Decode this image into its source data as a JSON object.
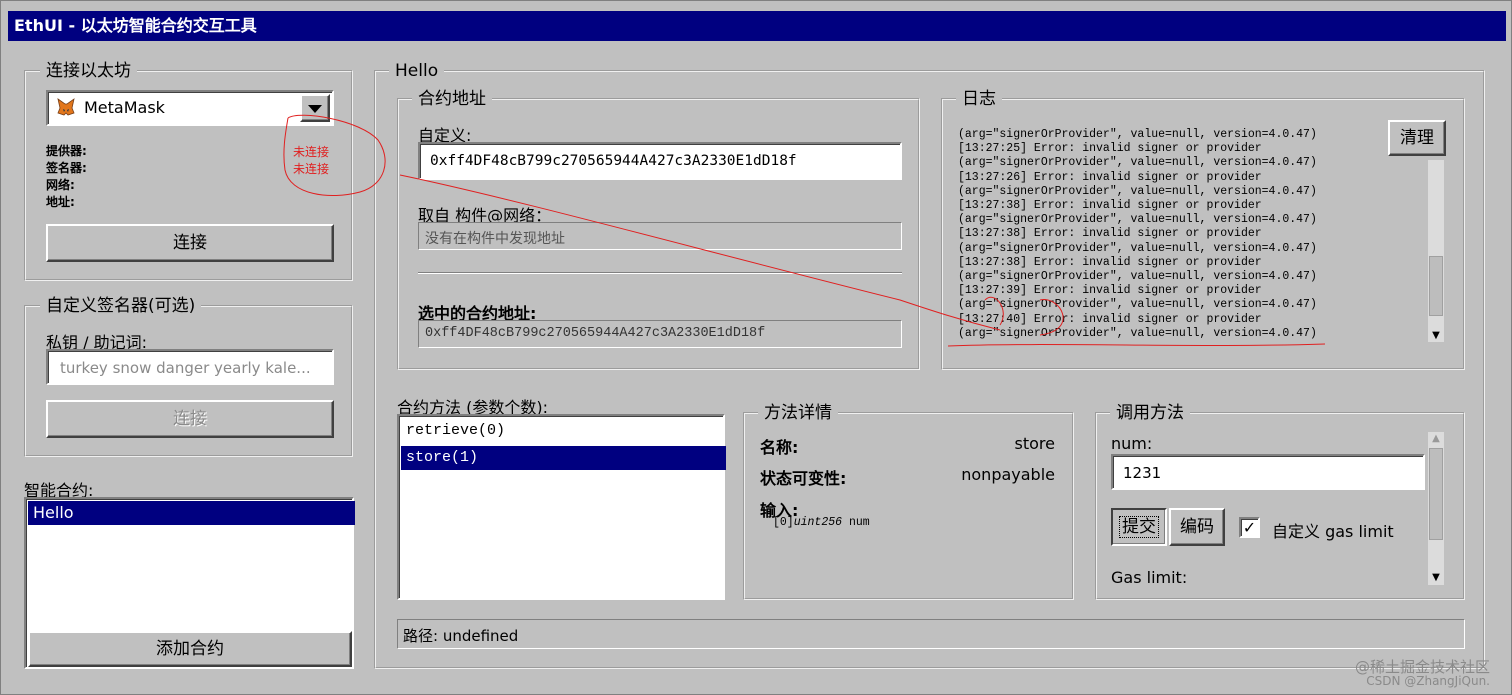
{
  "window": {
    "title": "EthUI - 以太坊智能合约交互工具"
  },
  "connect_group": {
    "title": "连接以太坊",
    "provider_select": "MetaMask",
    "labels": {
      "provider": "提供器:",
      "signer": "签名器:",
      "network": "网络:",
      "address": "地址:"
    },
    "annotation": [
      "未连接",
      "未连接"
    ],
    "connect_button": "连接"
  },
  "custom_signer": {
    "title": "自定义签名器(可选)",
    "key_label": "私钥 / 助记词:",
    "key_placeholder": "turkey snow danger yearly kale...",
    "connect_button": "连接"
  },
  "contracts": {
    "label": "智能合约:",
    "items": [
      "Hello"
    ],
    "selected": "Hello",
    "add_button": "添加合约"
  },
  "main": {
    "title": "Hello",
    "address_group": {
      "title": "合约地址",
      "custom_label": "自定义:",
      "custom_value": "0xff4DF48cB799c270565944A427c3A2330E1dD18f",
      "artifact_label": "取自 构件@网络：",
      "artifact_value": "没有在构件中发现地址",
      "selected_label": "选中的合约地址:",
      "selected_value": "0xff4DF48cB799c270565944A427c3A2330E1dD18f"
    },
    "log_group": {
      "title": "日志",
      "clear_button": "清理",
      "lines": [
        "(arg=\"signerOrProvider\", value=null, version=4.0.47)",
        "[13:27:25] Error: invalid signer or provider",
        "(arg=\"signerOrProvider\", value=null, version=4.0.47)",
        "[13:27:26] Error: invalid signer or provider",
        "(arg=\"signerOrProvider\", value=null, version=4.0.47)",
        "[13:27:38] Error: invalid signer or provider",
        "(arg=\"signerOrProvider\", value=null, version=4.0.47)",
        "[13:27:38] Error: invalid signer or provider",
        "(arg=\"signerOrProvider\", value=null, version=4.0.47)",
        "[13:27:38] Error: invalid signer or provider",
        "(arg=\"signerOrProvider\", value=null, version=4.0.47)",
        "[13:27:39] Error: invalid signer or provider",
        "(arg=\"signerOrProvider\", value=null, version=4.0.47)",
        "[13:27:40] Error: invalid signer or provider",
        "(arg=\"signerOrProvider\", value=null, version=4.0.47)"
      ]
    },
    "methods": {
      "label": "合约方法 (参数个数):",
      "items": [
        "retrieve(0)",
        "store(1)"
      ],
      "selected": "store(1)"
    },
    "method_detail": {
      "title": "方法详情",
      "name_label": "名称:",
      "name_value": "store",
      "mut_label": "状态可变性:",
      "mut_value": "nonpayable",
      "input_label": "输入:",
      "input_index": "[0]",
      "input_type": "uint256",
      "input_name": "num"
    },
    "invoke": {
      "title": "调用方法",
      "param_label": "num:",
      "param_value": "1231",
      "submit_button": "提交",
      "encode_button": "编码",
      "gas_checkbox_label": "自定义 gas limit",
      "gas_checked": true,
      "gas_limit_label": "Gas limit:"
    },
    "path": "路径: undefined"
  },
  "watermark": {
    "line1": "@稀土掘金技术社区",
    "line2": "CSDN @ZhangJiQun."
  },
  "colors": {
    "title_bg": "#000080",
    "selection": "#000080",
    "annotation": "#e02020"
  }
}
